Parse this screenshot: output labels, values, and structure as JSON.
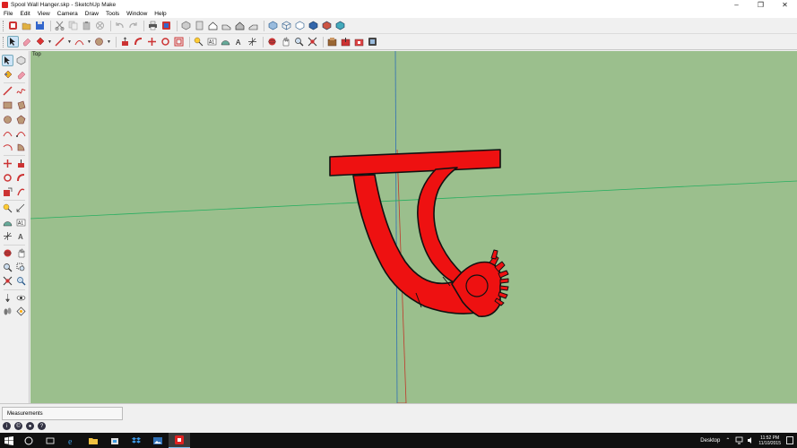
{
  "window": {
    "title": "Spool Wall Hanger.skp - SketchUp Make",
    "controls": {
      "minimize": "–",
      "maximize": "❐",
      "close": "✕"
    }
  },
  "menu": [
    "File",
    "Edit",
    "View",
    "Camera",
    "Draw",
    "Tools",
    "Window",
    "Help"
  ],
  "colors": {
    "viewport_bg": "#9bbf8d",
    "model_fill": "#ee1111",
    "model_stroke": "#111111",
    "axis_red": "#c0392b",
    "axis_green": "#27ae60",
    "axis_blue": "#2e6fb5",
    "taskbar": "#101010"
  },
  "toolbar_row1_icons": [
    "new-model-icon",
    "open-icon",
    "save-icon",
    "cut-icon",
    "copy-icon",
    "paste-icon",
    "erase-icon",
    "undo-icon",
    "redo-icon",
    "print-icon",
    "model-info-icon",
    "iso-view-icon",
    "top-view-icon",
    "front-view-icon",
    "right-view-icon",
    "back-view-icon",
    "left-view-icon",
    "xray-icon",
    "wireframe-icon",
    "hidden-line-icon",
    "shaded-icon",
    "shaded-textures-icon",
    "monochrome-icon"
  ],
  "toolbar_row2_icons": [
    "select-icon",
    "eraser-icon",
    "paint-bucket-icon",
    "line-icon",
    "freehand-icon",
    "arc-icon",
    "circle-icon",
    "push-pull-icon",
    "follow-me-icon",
    "move-icon",
    "rotate-icon",
    "offset-icon",
    "tape-measure-icon",
    "dimension-icon",
    "protractor-icon",
    "text-icon",
    "axes-icon",
    "orbit-icon",
    "pan-icon",
    "zoom-icon",
    "zoom-extents-icon",
    "warehouse-icon",
    "share-model-icon",
    "extension-warehouse-icon",
    "layout-icon"
  ],
  "viewport": {
    "scene_label": "Top"
  },
  "status": {
    "measurements_label": "Measurements"
  },
  "taskbar": {
    "desktop_label": "Desktop",
    "time": "11:52 PM",
    "date": "11/10/2015"
  }
}
